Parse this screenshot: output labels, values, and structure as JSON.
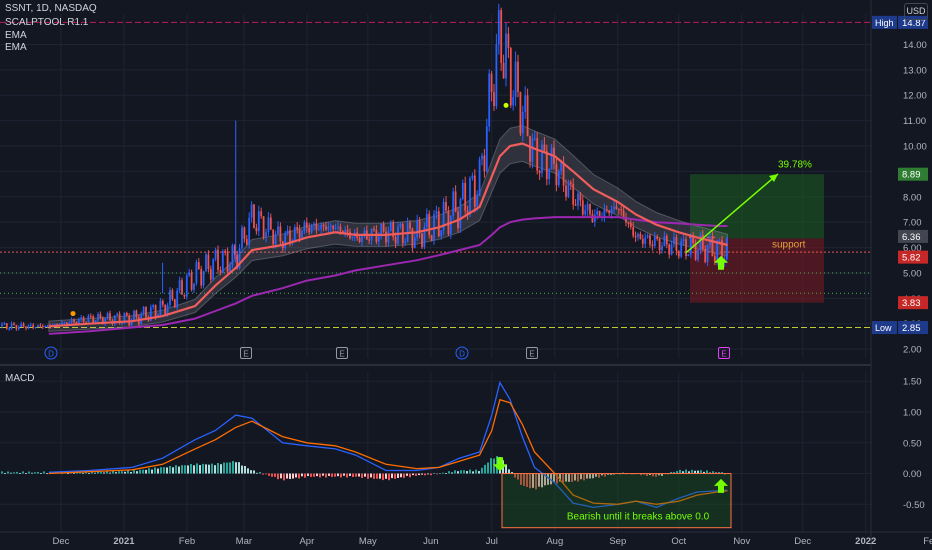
{
  "header": {
    "symbol": "SSNT, 1D, NASDAQ",
    "indicator_1": "SCALPTOOL R1.1",
    "indicator_2": "EMA",
    "indicator_3": "EMA",
    "currency": "USD"
  },
  "chart_data": [
    {
      "type": "candlestick",
      "title": "SSNT, 1D, NASDAQ",
      "y_ticks": [
        2.0,
        3.0,
        4.0,
        5.0,
        6.0,
        7.0,
        8.0,
        9.0,
        10.0,
        11.0,
        12.0,
        13.0,
        14.0
      ],
      "y_tick_labels": [
        "2.00",
        "3.00",
        "4.00",
        "5.00",
        "6.00",
        "7.00",
        "8.00",
        "9.00",
        "10.00",
        "11.00",
        "12.00",
        "13.00",
        "14.00"
      ],
      "ylim": [
        1.65,
        15.2
      ],
      "x_tick_labels": [
        "Dec",
        "2021",
        "Feb",
        "Mar",
        "Apr",
        "May",
        "Jun",
        "Jul",
        "Aug",
        "Sep",
        "Oct",
        "Nov",
        "Dec",
        "2022",
        "Fe"
      ],
      "price_series": {
        "name": "close",
        "dates": [
          "2020-11-25",
          "2020-12-15",
          "2021-01-05",
          "2021-01-20",
          "2021-02-05",
          "2021-02-15",
          "2021-02-25",
          "2021-03-05",
          "2021-03-20",
          "2021-04-01",
          "2021-04-15",
          "2021-04-25",
          "2021-05-10",
          "2021-05-25",
          "2021-06-05",
          "2021-06-15",
          "2021-06-25",
          "2021-07-01",
          "2021-07-05",
          "2021-07-10",
          "2021-07-16",
          "2021-07-22",
          "2021-08-01",
          "2021-08-10",
          "2021-08-20",
          "2021-09-01",
          "2021-09-10",
          "2021-09-20",
          "2021-10-01",
          "2021-10-10",
          "2021-10-20",
          "2021-10-25"
        ],
        "values": [
          2.9,
          3.2,
          3.2,
          3.6,
          4.9,
          5.4,
          5.6,
          7.2,
          6.3,
          6.8,
          6.8,
          6.4,
          6.6,
          6.5,
          7.0,
          7.6,
          8.6,
          12.4,
          14.3,
          12.8,
          11.4,
          9.6,
          9.2,
          8.0,
          7.2,
          7.6,
          6.4,
          6.2,
          6.0,
          6.0,
          5.9,
          5.82
        ]
      },
      "ema_fast": {
        "name": "EMA",
        "values": [
          2.9,
          3.0,
          3.1,
          3.3,
          3.7,
          4.5,
          5.2,
          5.9,
          6.1,
          6.4,
          6.6,
          6.5,
          6.5,
          6.6,
          6.8,
          7.1,
          7.6,
          8.8,
          9.6,
          10.0,
          10.1,
          9.9,
          9.6,
          9.0,
          8.3,
          7.8,
          7.3,
          6.9,
          6.6,
          6.4,
          6.2,
          6.1
        ]
      },
      "ema_slow": {
        "name": "EMA",
        "values": [
          2.6,
          2.7,
          2.85,
          2.95,
          3.2,
          3.5,
          3.8,
          4.1,
          4.4,
          4.7,
          4.9,
          5.1,
          5.3,
          5.5,
          5.7,
          5.9,
          6.1,
          6.5,
          6.8,
          7.0,
          7.1,
          7.15,
          7.2,
          7.2,
          7.2,
          7.2,
          7.1,
          7.0,
          6.95,
          6.9,
          6.85,
          6.85
        ]
      },
      "price_labels": [
        {
          "label": "High",
          "value": "14.87"
        },
        {
          "label": "",
          "value": "8.89"
        },
        {
          "label": "",
          "value": "6.36"
        },
        {
          "label": "",
          "value": "5.82"
        },
        {
          "label": "",
          "value": "3.83"
        },
        {
          "label": "Low",
          "value": "2.85"
        }
      ],
      "annotations": {
        "target_percent": "39.78%",
        "support_text": "support",
        "long_position": {
          "entry": 6.36,
          "target": 8.89,
          "stop": 3.83
        }
      },
      "event_badges": [
        "D",
        "E",
        "E",
        "D",
        "E",
        "E"
      ],
      "colors": {
        "up": "#2962ff",
        "down": "#ef5350",
        "ema_fast": "#f15c5c",
        "ema_slow": "#9c27b0",
        "target_zone": "#1b5e20",
        "stop_zone": "#801922",
        "arrow": "#76ff03"
      }
    },
    {
      "type": "line",
      "title": "MACD",
      "y_ticks": [
        -0.5,
        0.0,
        0.5,
        1.0,
        1.5
      ],
      "y_tick_labels": [
        "-0.50",
        "0.00",
        "0.50",
        "1.00",
        "1.50"
      ],
      "ylim": [
        -0.95,
        1.65
      ],
      "series": [
        {
          "name": "",
          "values": [
            0.02,
            0.05,
            0.1,
            0.25,
            0.55,
            0.7,
            0.95,
            0.9,
            0.5,
            0.45,
            0.4,
            0.3,
            0.05,
            0.05,
            0.1,
            0.25,
            0.35,
            0.95,
            1.48,
            1.2,
            0.6,
            0.1,
            -0.15,
            -0.48,
            -0.55,
            -0.5,
            -0.45,
            -0.55,
            -0.4,
            -0.3,
            -0.28,
            -0.27
          ]
        },
        {
          "name": "",
          "values": [
            0.0,
            0.03,
            0.06,
            0.15,
            0.4,
            0.55,
            0.75,
            0.85,
            0.6,
            0.5,
            0.45,
            0.35,
            0.15,
            0.08,
            0.1,
            0.2,
            0.3,
            0.7,
            1.2,
            1.15,
            0.8,
            0.35,
            0.0,
            -0.35,
            -0.48,
            -0.5,
            -0.45,
            -0.5,
            -0.45,
            -0.35,
            -0.3,
            -0.28
          ]
        }
      ],
      "annotation_text": "Bearish until it breaks above 0.0"
    }
  ]
}
